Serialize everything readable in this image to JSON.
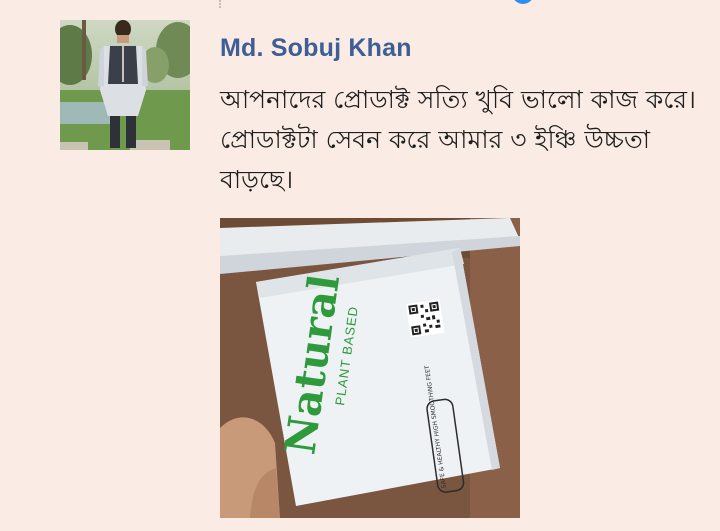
{
  "comment": {
    "author_name": "Md. Sobuj Khan",
    "text": "আপনাদের প্রোডাক্ট সত্যি খুবি ভালো কাজ করে।প্রোডাক্টটা সেবন করে আমার ৩ ইঞ্চি উচ্চতা বাড়ছে।"
  },
  "attachment_photo": {
    "brand_text": "Natural",
    "subtitle_text": "PLANT BASED",
    "label_text": "SAFE & HEALTHY HIGH SMOOTHING FEET"
  },
  "icons": {
    "avatar": "profile-photo",
    "reaction": "reaction-icon",
    "qr": "qr-code"
  },
  "colors": {
    "background": "#faece4",
    "author_name": "#3e5e95",
    "text": "#1e1e1e",
    "brand_green": "#2e9a3c",
    "reaction_blue": "#2f8cf0"
  }
}
